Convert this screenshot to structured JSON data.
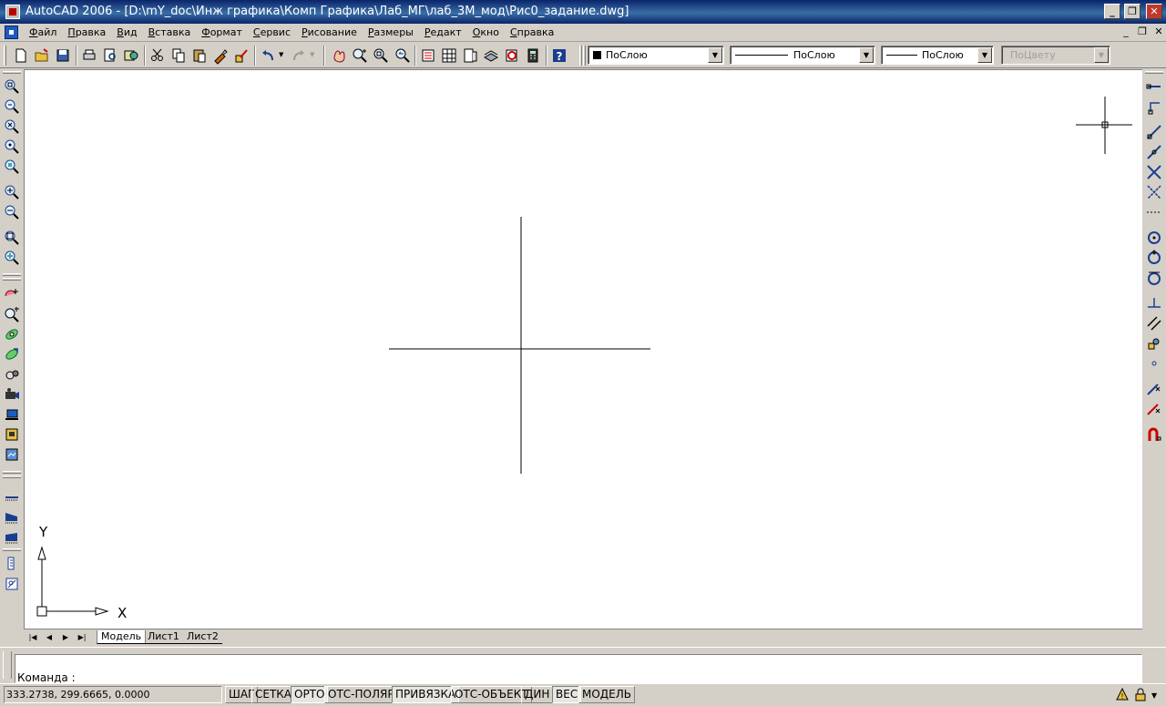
{
  "window": {
    "title": "AutoCAD 2006 - [D:\\mY_doc\\Инж графика\\Комп Графика\\Лаб_МГ\\лаб_3М_мод\\Рис0_задание.dwg]",
    "controls": [
      "minimize-icon",
      "restore-icon",
      "close-icon"
    ]
  },
  "menu": {
    "items": [
      "Файл",
      "Правка",
      "Вид",
      "Вставка",
      "Формат",
      "Сервис",
      "Рисование",
      "Размеры",
      "Редакт",
      "Окно",
      "Справка"
    ]
  },
  "toolbar": {
    "icons": [
      "new-icon",
      "open-icon",
      "save-icon",
      "plot-icon",
      "plot-preview-icon",
      "publish-icon",
      "cut-icon",
      "copy-icon",
      "paste-icon",
      "match-properties-icon",
      "block-editor-icon",
      "undo-icon",
      "redo-icon",
      "pan-icon",
      "zoom-realtime-icon",
      "zoom-window-icon",
      "zoom-previous-icon",
      "properties-icon",
      "design-center-icon",
      "tool-palettes-icon",
      "sheet-set-icon",
      "markup-icon",
      "calculator-icon",
      "help-icon"
    ],
    "color_combo": "ПоСлою",
    "linetype_combo": "ПоСлою",
    "lineweight_combo": "ПоСлою",
    "plotstyle_combo": "ПоЦвету"
  },
  "left_toolbar": {
    "icons": [
      "zoom-window-icon",
      "zoom-dynamic-icon",
      "zoom-scale-icon",
      "zoom-center-icon",
      "zoom-object-icon",
      "zoom-in-icon",
      "zoom-out-icon",
      "zoom-all-icon",
      "zoom-extents-icon",
      "pan-realtime-icon",
      "zoom-realtime-icon",
      "orbit-icon",
      "free-orbit-icon",
      "continuous-orbit-icon",
      "camera-icon",
      "swivel-icon",
      "walk-icon",
      "view-icon",
      "dimension-linear-icon",
      "dimension-aligned-icon",
      "dimension-baseline-icon",
      "layer-icon",
      "properties-list-icon"
    ]
  },
  "right_toolbar": {
    "icons": [
      "snap-endpoint-icon",
      "snap-tracking-icon",
      "snap-midpoint-icon",
      "snap-intersection-icon",
      "snap-apparent-icon",
      "snap-extension-icon",
      "snap-center-icon",
      "snap-quadrant-icon",
      "snap-tangent-icon",
      "snap-perpendicular-icon",
      "snap-parallel-icon",
      "snap-insert-icon",
      "snap-node-icon",
      "snap-nearest-icon",
      "snap-none-icon",
      "snap-settings-icon"
    ]
  },
  "ucs": {
    "x_label": "X",
    "y_label": "Y"
  },
  "layout_tabs": [
    "Модель",
    "Лист1",
    "Лист2"
  ],
  "command": {
    "prompt": "Команда :"
  },
  "status": {
    "coordinates": "333.2738, 299.6665, 0.0000",
    "buttons": [
      {
        "label": "ШАГ",
        "on": false
      },
      {
        "label": "СЕТКА",
        "on": false
      },
      {
        "label": "ОРТО",
        "on": true
      },
      {
        "label": "ОТС-ПОЛЯР",
        "on": false
      },
      {
        "label": "ПРИВЯЗКА",
        "on": true
      },
      {
        "label": "ОТС-ОБЪЕКТ",
        "on": false
      },
      {
        "label": "ДИН",
        "on": false
      },
      {
        "label": "ВЕС",
        "on": true
      },
      {
        "label": "МОДЕЛЬ",
        "on": false
      }
    ]
  },
  "colors": {
    "titlebar": "#0a246a",
    "canvas": "#ffffff",
    "chrome": "#d4d0c8",
    "accent_red": "#c0392b"
  }
}
